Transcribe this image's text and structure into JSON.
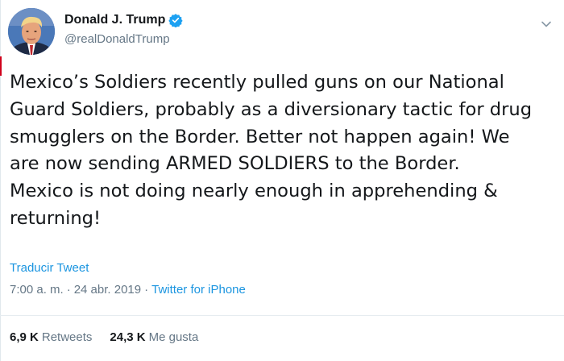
{
  "author": {
    "display_name": "Donald J. Trump",
    "handle": "@realDonaldTrump",
    "verified": true
  },
  "icons": {
    "verified": "verified-badge-icon",
    "caret": "chevron-down-icon",
    "avatar": "profile-photo"
  },
  "tweet": {
    "text": "Mexico’s Soldiers recently pulled guns on our National\nGuard Soldiers, probably as a diversionary tactic for drug\nsmugglers on the Border. Better not happen again! We\nare now sending ARMED SOLDIERS to the Border.\nMexico is not doing nearly enough in apprehending &\nreturning!",
    "translate_label": "Traducir Tweet",
    "time": "7:00 a. m.",
    "date": "24 abr. 2019",
    "separator": "·",
    "source": "Twitter for iPhone"
  },
  "stats": {
    "retweets_count": "6,9 K",
    "retweets_label": "Retweets",
    "likes_count": "24,3 K",
    "likes_label": "Me gusta"
  },
  "colors": {
    "link": "#1b95e0",
    "muted": "#657786",
    "text": "#14171a",
    "verified": "#1da1f2"
  }
}
